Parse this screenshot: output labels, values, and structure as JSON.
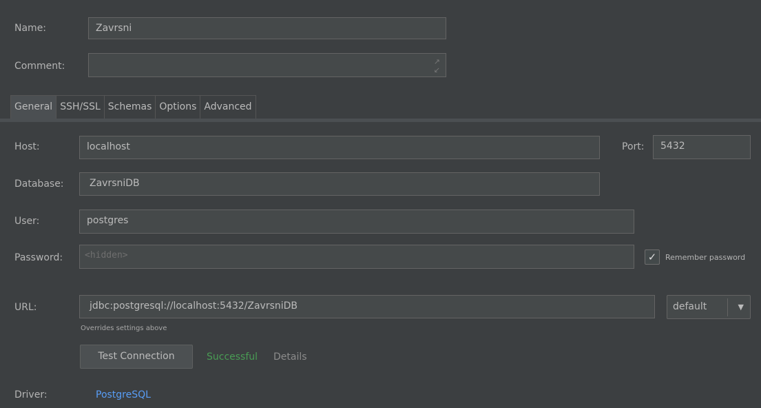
{
  "header": {
    "name_label": "Name:",
    "name_value": "Zavrsni",
    "comment_label": "Comment:",
    "comment_value": ""
  },
  "tabs": [
    {
      "label": "General",
      "active": true
    },
    {
      "label": "SSH/SSL",
      "active": false
    },
    {
      "label": "Schemas",
      "active": false
    },
    {
      "label": "Options",
      "active": false
    },
    {
      "label": "Advanced",
      "active": false
    }
  ],
  "general": {
    "host_label": "Host:",
    "host_value": "localhost",
    "port_label": "Port:",
    "port_value": "5432",
    "database_label": "Database:",
    "database_value": "ZavrsniDB",
    "user_label": "User:",
    "user_value": "postgres",
    "password_label": "Password:",
    "password_placeholder": "<hidden>",
    "remember_password_label": "Remember password",
    "remember_password_checked": true,
    "url_label": "URL:",
    "url_value": "jdbc:postgresql://localhost:5432/ZavrsniDB",
    "url_mode": "default",
    "overrides_note": "Overrides settings above",
    "test_connection_label": "Test Connection",
    "test_status": "Successful",
    "details_label": "Details",
    "driver_label": "Driver:",
    "driver_value": "PostgreSQL"
  },
  "icons": {
    "expand": "expand-icon",
    "check": "check-icon",
    "dropdown": "chevron-down-icon"
  },
  "colors": {
    "background": "#3c3f41",
    "field": "#45494a",
    "link": "#589df6",
    "success": "#499c54"
  }
}
